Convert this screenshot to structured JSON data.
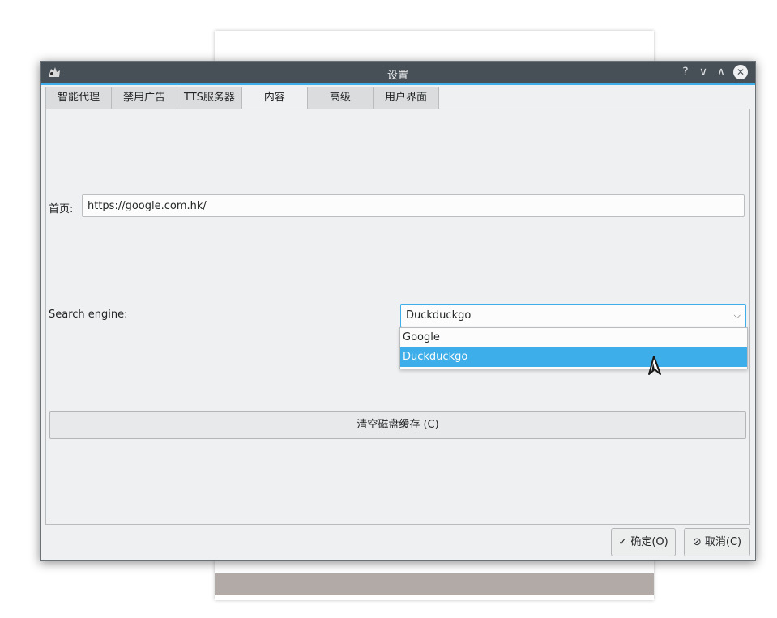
{
  "dialog": {
    "title": "设置",
    "title_buttons": [
      "?",
      "∨",
      "∧"
    ],
    "close_glyph": "✕"
  },
  "tabs": [
    {
      "label": "智能代理"
    },
    {
      "label": "禁用广告"
    },
    {
      "label": "TTS服务器"
    },
    {
      "label": "内容",
      "active": true
    },
    {
      "label": "高级"
    },
    {
      "label": "用户界面"
    }
  ],
  "content": {
    "homepage_label": "首页:",
    "homepage_value": "https://google.com.hk/",
    "search_label": "Search engine:",
    "search_selected": "Duckduckgo",
    "search_options": [
      "Google",
      "Duckduckgo"
    ],
    "clear_cache_label": "清空磁盘缓存 (C)"
  },
  "footer": {
    "ok_label": "✓ 确定(O)",
    "cancel_label": "⊘ 取消(C)"
  },
  "colors": {
    "accent": "#3daee9",
    "titlebar": "#475057",
    "window_bg": "#eff0f1"
  }
}
